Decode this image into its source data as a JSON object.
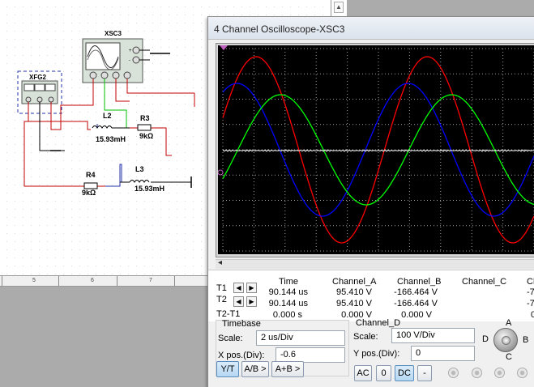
{
  "schematic": {
    "scope_label": "XSC3",
    "fgen_label": "XFG2",
    "fgen_waveforms": [
      "∿",
      "⩏",
      "Π"
    ],
    "fgen_terminals": [
      "+",
      "COM",
      "−"
    ],
    "components": [
      {
        "ref": "L2",
        "value": "15.93mH"
      },
      {
        "ref": "R3",
        "value": "9kΩ"
      },
      {
        "ref": "R4",
        "value": "9kΩ"
      },
      {
        "ref": "L3",
        "value": "15.93mH"
      }
    ],
    "ruler_labels": [
      "5",
      "6",
      "7"
    ],
    "wire_color": "#c00000",
    "probe_wire_color": "#00c000"
  },
  "scope": {
    "title": "4 Channel Oscilloscope-XSC3",
    "screen": {
      "background": "#000000",
      "grid_color": "#a0a0a0",
      "channel_colors": {
        "A": "#ff0000",
        "B": "#0000ff",
        "C": "#00ff00",
        "D": "#ffffff"
      }
    },
    "measurements": {
      "headers": [
        "Time",
        "Channel_A",
        "Channel_B",
        "Channel_C",
        "Ch"
      ],
      "rows": [
        {
          "label": "T1",
          "time": "90.144 us",
          "a": "95.410 V",
          "b": "-166.464 V",
          "d": "-7"
        },
        {
          "label": "T2",
          "time": "90.144 us",
          "a": "95.410 V",
          "b": "-166.464 V",
          "d": "-7"
        },
        {
          "label": "T2-T1",
          "time": "0.000 s",
          "a": "0.000 V",
          "b": "0.000 V",
          "d": "0"
        }
      ]
    },
    "timebase": {
      "title": "Timebase",
      "scale_label": "Scale:",
      "scale_value": "2 us/Div",
      "xpos_label": "X pos.(Div):",
      "xpos_value": "-0.6",
      "buttons": [
        "Y/T",
        "A/B >",
        "A+B >"
      ]
    },
    "channel": {
      "title": "Channel_D",
      "scale_label": "Scale:",
      "scale_value": "100  V/Div",
      "ypos_label": "Y pos.(Div):",
      "ypos_value": "0",
      "buttons": [
        "AC",
        "0",
        "DC",
        "-"
      ]
    },
    "selector": {
      "labels": [
        "A",
        "B",
        "C",
        "D"
      ]
    }
  }
}
